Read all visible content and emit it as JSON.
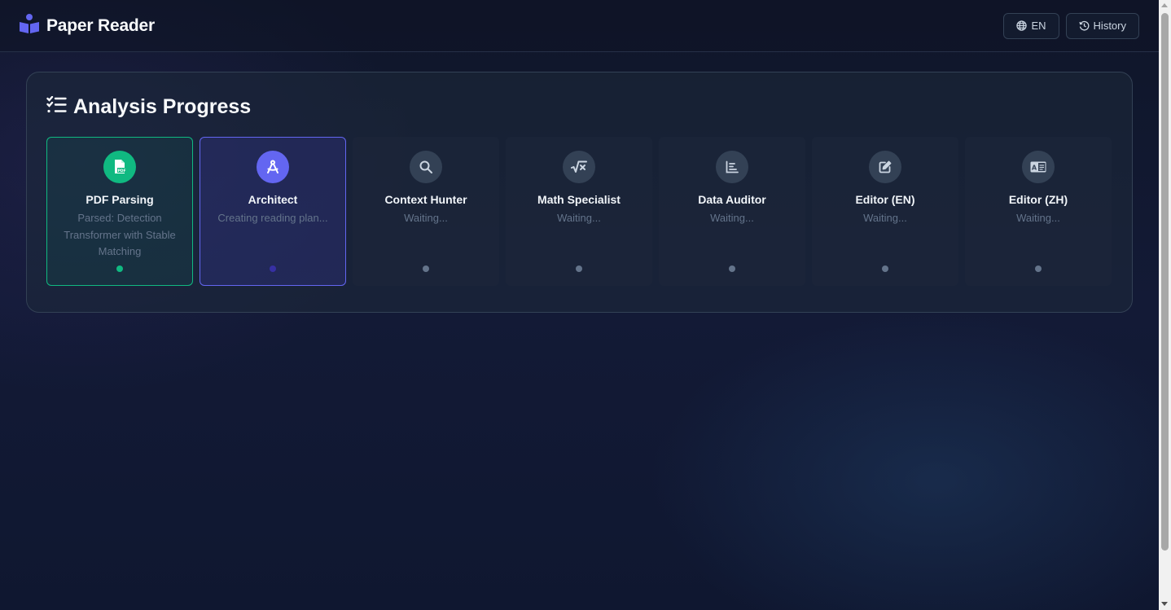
{
  "app": {
    "title": "Paper Reader",
    "logo_icon": "book-reader-icon"
  },
  "header": {
    "language_label": "EN",
    "language_icon": "globe-icon",
    "history_label": "History",
    "history_icon": "history-icon"
  },
  "progress": {
    "title": "Analysis Progress",
    "title_icon": "tasks-list-icon",
    "steps": [
      {
        "title": "PDF Parsing",
        "status": "Parsed: Detection Transformer with Stable Matching",
        "state": "done",
        "icon": "file-pdf-icon"
      },
      {
        "title": "Architect",
        "status": "Creating reading plan...",
        "state": "active",
        "icon": "compass-drafting-icon"
      },
      {
        "title": "Context Hunter",
        "status": "Waiting...",
        "state": "waiting",
        "icon": "search-icon"
      },
      {
        "title": "Math Specialist",
        "status": "Waiting...",
        "state": "waiting",
        "icon": "square-root-icon"
      },
      {
        "title": "Data Auditor",
        "status": "Waiting...",
        "state": "waiting",
        "icon": "chart-bar-icon"
      },
      {
        "title": "Editor (EN)",
        "status": "Waiting...",
        "state": "waiting",
        "icon": "edit-icon"
      },
      {
        "title": "Editor (ZH)",
        "status": "Waiting...",
        "state": "waiting",
        "icon": "language-card-icon"
      }
    ]
  },
  "colors": {
    "done": "#10b981",
    "active": "#6366f1",
    "waiting": "#334155",
    "brand": "#6366f1"
  }
}
